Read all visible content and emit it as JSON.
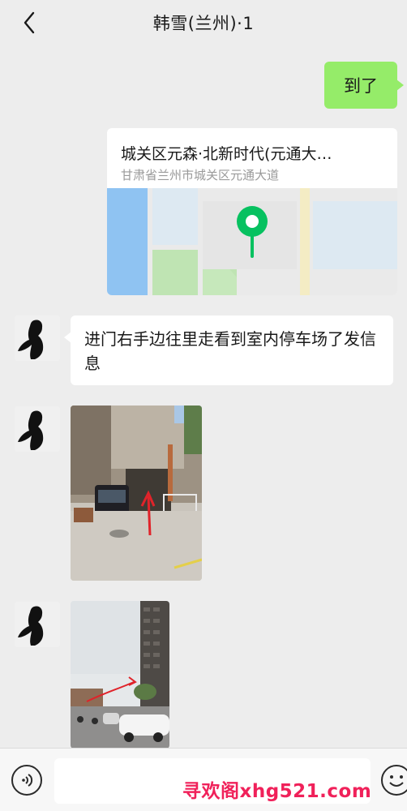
{
  "header": {
    "title": "韩雪(兰州)·1",
    "back_icon": "chevron-left-icon"
  },
  "messages": {
    "sent_text": "到了",
    "location": {
      "name": "城关区元森·北新时代(元通大…",
      "address": "甘肃省兰州市城关区元通大道",
      "pin_color": "#07c160"
    },
    "received_text": "进门右手边往里走看到室内停车场了发信息"
  },
  "input_bar": {
    "voice_icon": "voice-icon",
    "emoji_icon": "emoji-icon",
    "placeholder": ""
  },
  "watermark": "寻欢阁xhg521.com",
  "colors": {
    "background": "#ededed",
    "sent_bubble": "#95ec69",
    "received_bubble": "#ffffff",
    "watermark": "#f0215a"
  }
}
